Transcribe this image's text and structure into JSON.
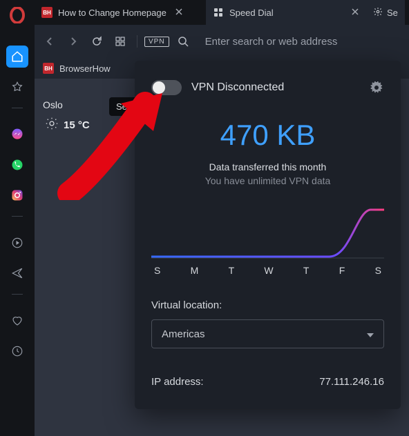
{
  "tabs": [
    {
      "favicon_text": "BH",
      "title": "How to Change Homepage"
    },
    {
      "title": "Speed Dial"
    },
    {
      "title": "Se"
    }
  ],
  "toolbar": {
    "vpn_badge": "VPN",
    "search_placeholder": "Enter search or web address"
  },
  "bookmarks": [
    {
      "favicon_text": "BH",
      "title": "BrowserHow"
    }
  ],
  "content": {
    "weather": {
      "city": "Oslo",
      "temp": "15 °C"
    },
    "tooltip_text": "Set up y"
  },
  "vpn": {
    "status": "VPN Disconnected",
    "data_amount": "470 KB",
    "data_label": "Data transferred this month",
    "data_sub": "You have unlimited VPN data",
    "days": [
      "S",
      "M",
      "T",
      "W",
      "T",
      "F",
      "S"
    ],
    "location_label": "Virtual location:",
    "location_value": "Americas",
    "ip_label": "IP address:",
    "ip_value": "77.111.246.16"
  }
}
